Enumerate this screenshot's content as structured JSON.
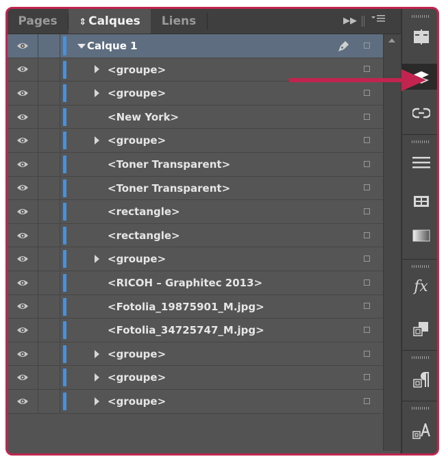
{
  "tabs": [
    {
      "label": "Pages",
      "active": false
    },
    {
      "label": "Calques",
      "active": true,
      "prefix": "⇕"
    },
    {
      "label": "Liens",
      "active": false
    }
  ],
  "toolbar": {
    "forward_icon": "double-chevron-right-icon",
    "menu_icon": "panel-menu-icon"
  },
  "layers": [
    {
      "label": "Calque 1",
      "level": 0,
      "expandable": true,
      "expanded": true,
      "selected": true
    },
    {
      "label": "<groupe>",
      "level": 1,
      "expandable": true
    },
    {
      "label": "<groupe>",
      "level": 1,
      "expandable": true
    },
    {
      "label": "<New York>",
      "level": 1,
      "expandable": false
    },
    {
      "label": "<groupe>",
      "level": 1,
      "expandable": true
    },
    {
      "label": "<Toner Transparent>",
      "level": 1,
      "expandable": false
    },
    {
      "label": "<Toner Transparent>",
      "level": 1,
      "expandable": false
    },
    {
      "label": "<rectangle>",
      "level": 1,
      "expandable": false
    },
    {
      "label": "<rectangle>",
      "level": 1,
      "expandable": false
    },
    {
      "label": "<groupe>",
      "level": 1,
      "expandable": true
    },
    {
      "label": "<RICOH – Graphitec 2013>",
      "level": 1,
      "expandable": false
    },
    {
      "label": "<Fotolia_19875901_M.jpg>",
      "level": 1,
      "expandable": false
    },
    {
      "label": "<Fotolia_34725747_M.jpg>",
      "level": 1,
      "expandable": false
    },
    {
      "label": "<groupe>",
      "level": 1,
      "expandable": true
    },
    {
      "label": "<groupe>",
      "level": 1,
      "expandable": true
    },
    {
      "label": "<groupe>",
      "level": 1,
      "expandable": true
    }
  ],
  "strip_icons": [
    {
      "name": "pages-icon"
    },
    {
      "name": "layers-icon",
      "active": true
    },
    {
      "name": "links-icon"
    },
    {
      "name": "stroke-icon"
    },
    {
      "name": "swatches-icon"
    },
    {
      "name": "gradient-icon"
    },
    {
      "name": "effects-icon",
      "text": "fx"
    },
    {
      "name": "object-styles-icon"
    },
    {
      "name": "paragraph-styles-icon"
    },
    {
      "name": "character-styles-icon"
    }
  ],
  "colors": {
    "layer_color": "#4a90d9",
    "highlight_arrow": "#c2244f",
    "selected_row": "#5e6e80"
  }
}
